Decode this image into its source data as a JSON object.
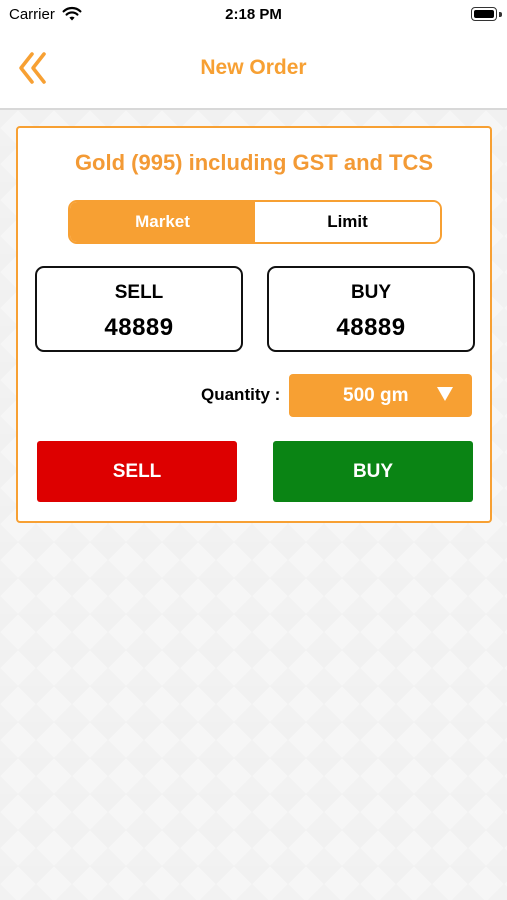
{
  "status_bar": {
    "carrier": "Carrier",
    "time": "2:18 PM"
  },
  "nav": {
    "title": "New Order",
    "back_icon": "double-chevron-left-icon"
  },
  "card": {
    "title": "Gold (995) including GST and TCS",
    "tabs": {
      "market": "Market",
      "limit": "Limit",
      "selected": "Market"
    },
    "sell": {
      "label": "SELL",
      "value": "48889"
    },
    "buy": {
      "label": "BUY",
      "value": "48889"
    },
    "quantity": {
      "label": "Quantity :",
      "value": "500 gm",
      "arrow": "▼"
    },
    "actions": {
      "sell": "SELL",
      "buy": "BUY"
    }
  },
  "colors": {
    "accent": "#f7a033",
    "sell": "#dd0000",
    "buy": "#0a8414"
  }
}
